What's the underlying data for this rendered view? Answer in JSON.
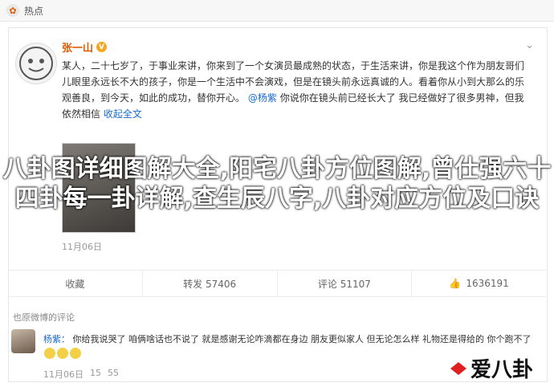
{
  "tab": {
    "label": "热点"
  },
  "post": {
    "author": "张一山",
    "badge": "V",
    "text_1": "某人，二十七岁了，于事业来讲，你来到了一个女演员最成熟的状态，于生活来讲，你是我这个作为朋友哥们儿眼里永远长不大的孩子，你是一个生活中不会演戏，但是在镜头前永远真诚的人。看着你从小到大那么的乐观善良，到今天，如此的成功，替你开心。",
    "text_link": "@杨紫",
    "text_2": "你说你在镜头前已经长大了",
    "text_3": "我已经做好了很多男神，但我依然相信",
    "collapse": "收起全文",
    "time": "11月06日 ",
    "source": ""
  },
  "overlay_title": "八卦图详细图解大全,阳宅八卦方位图解,曾仕强六十四卦每一卦详解,查生辰八字,八卦对应方位及口诀",
  "actions": {
    "collect": "收藏",
    "repost": "转发 57406",
    "comment": "评论 51107",
    "like": "1636191"
  },
  "comments": {
    "header": "也原微博的评论",
    "name": "杨紫：",
    "text": "你给我说哭了 咱俩啥话也不说了 就是感谢无论咋滴都在身边 朋友更似家人 但无论怎么样 礼物还是得给的 你个跑不了",
    "time": "11月06日 ",
    "like": "15 ",
    "reply": "55"
  },
  "watermark": "爱八卦"
}
